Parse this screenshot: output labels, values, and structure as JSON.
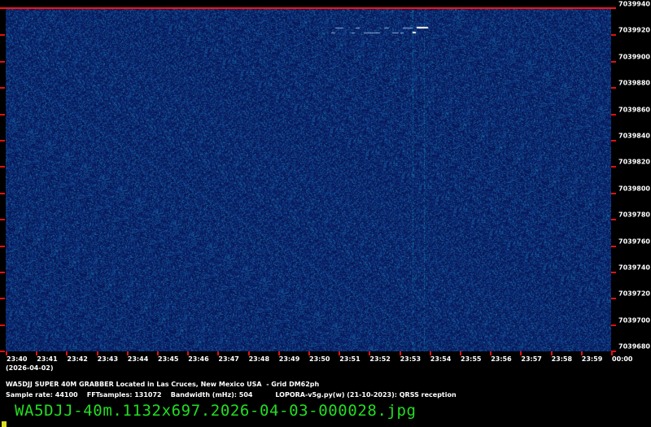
{
  "y_axis": {
    "labels": [
      "7039940",
      "7039920",
      "7039900",
      "7039880",
      "7039860",
      "7039840",
      "7039820",
      "7039800",
      "7039780",
      "7039760",
      "7039740",
      "7039720",
      "7039700",
      "7039680"
    ]
  },
  "x_axis": {
    "labels": [
      "23:40",
      "23:41",
      "23:42",
      "23:43",
      "23:44",
      "23:45",
      "23:46",
      "23:47",
      "23:48",
      "23:49",
      "23:50",
      "23:51",
      "23:52",
      "23:53",
      "23:54",
      "23:55",
      "23:56",
      "23:57",
      "23:58",
      "23:59",
      "00:00"
    ],
    "date": "(2026-04-02)"
  },
  "info": {
    "title": "WA5DJJ SUPER 40M GRABBER Located in Las Cruces, New Mexico USA  - Grid DM62ph",
    "params": "Sample rate: 44100    FFTsamples: 131072    Bandwidth (mHz): 504          LOPORA-v5g.py(w) (21-10-2023): QRSS reception"
  },
  "filename": "WA5DJJ-40m.1132x697.2026-04-03-000028.jpg",
  "colors": {
    "background": "#0b2266",
    "grid_tick": "#e01010",
    "filename": "#22dd22"
  }
}
